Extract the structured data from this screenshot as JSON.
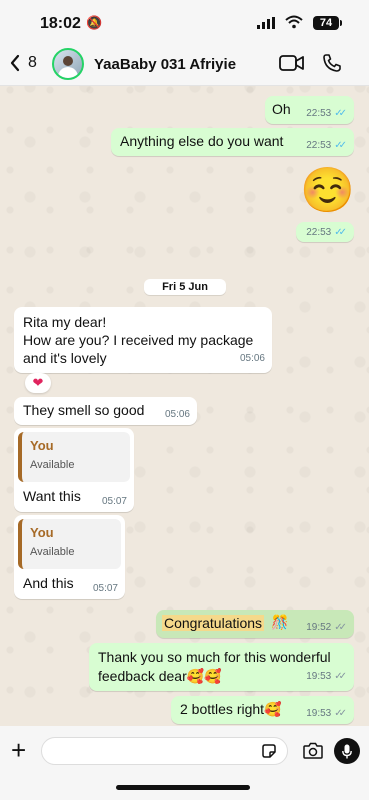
{
  "status_bar": {
    "time": "18:02",
    "battery": "74"
  },
  "header": {
    "back_count": "8",
    "contact_name": "YaaBaby 031 Afriyie"
  },
  "messages": {
    "m1": {
      "text": "Oh",
      "time": "22:53"
    },
    "m2": {
      "text": "Anything else do you want",
      "time": "22:53"
    },
    "m3": {
      "emoji": "☺️",
      "time": "22:53"
    },
    "date_divider": "Fri 5 Jun",
    "m4": {
      "text_line1": "Rita my dear!",
      "text_line2": "How are you? I received my package",
      "text_line3": "and it's lovely",
      "time": "05:06",
      "reaction": "❤"
    },
    "m5": {
      "text": "They smell so good",
      "time": "05:06"
    },
    "m6": {
      "quote_author": "You",
      "quote_text": "Available",
      "text": "Want this",
      "time": "05:07"
    },
    "m7": {
      "quote_author": "You",
      "quote_text": "Available",
      "text": "And this",
      "time": "05:07"
    },
    "m8": {
      "text": "Congratulations",
      "emoji": "🎊",
      "time": "19:52"
    },
    "m9": {
      "text_line1": "Thank you so much for this wonderful",
      "text_line2": "feedback dear🥰🥰",
      "time": "19:53"
    },
    "m10": {
      "text": "2 bottles right🥰",
      "time": "19:53"
    }
  },
  "composer": {
    "placeholder": ""
  }
}
